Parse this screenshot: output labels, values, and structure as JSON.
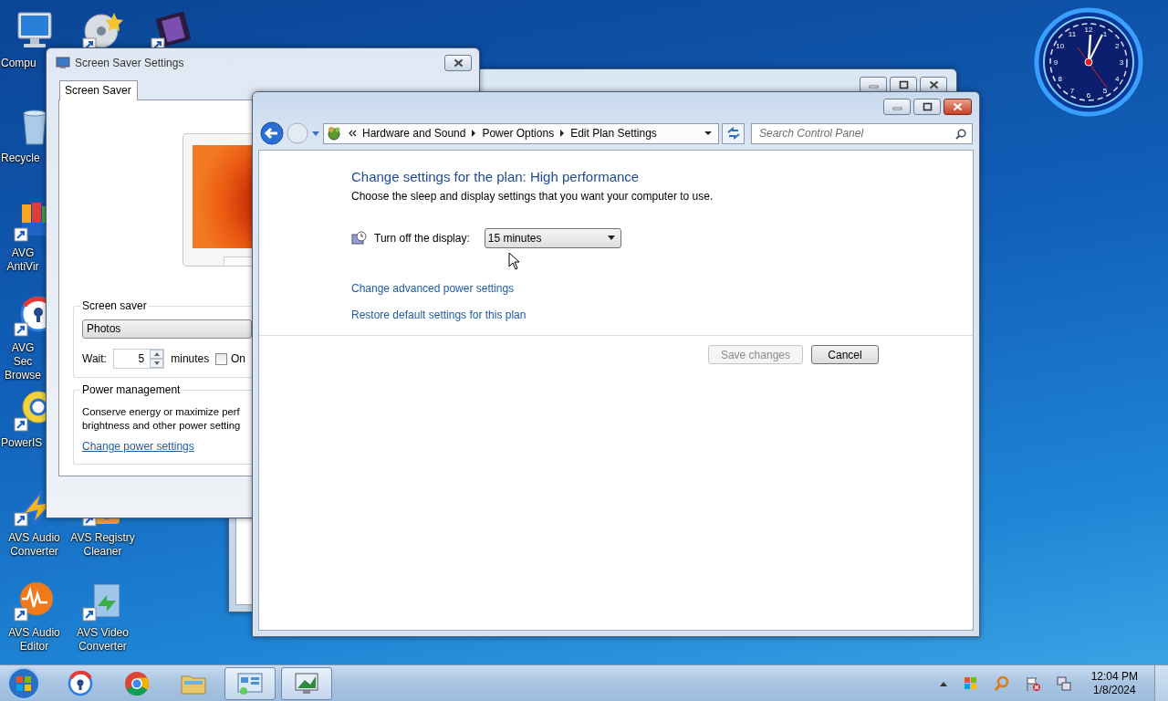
{
  "desktop_icons": [
    {
      "kind": "computer",
      "label": "Compu"
    },
    {
      "kind": "disc"
    },
    {
      "kind": "film"
    },
    {
      "kind": "recycle-bin",
      "label": "Recycle"
    },
    {
      "kind": "avg-antivirus",
      "label": "AVG AntiVir"
    },
    {
      "kind": "avg-browser",
      "label": "AVG Sec Browse"
    },
    {
      "kind": "poweriso",
      "label": "PowerIS"
    },
    {
      "kind": "avs-audio-converter",
      "label": "AVS Audio Converter"
    },
    {
      "kind": "avs-registry-cleaner",
      "label": "AVS Registry Cleaner"
    },
    {
      "kind": "avs-audio-editor",
      "label": "AVS Audio Editor"
    },
    {
      "kind": "avs-video-converter",
      "label": "AVS Video Converter"
    }
  ],
  "clock_gadget": {
    "numerals": [
      "12",
      "1",
      "2",
      "3",
      "4",
      "5",
      "6",
      "7",
      "8",
      "9",
      "10",
      "11"
    ]
  },
  "screen_saver_window": {
    "title": "Screen Saver Settings",
    "tabs": [
      {
        "label": "Screen Saver",
        "selected": true
      }
    ],
    "screen_saver_group": {
      "label": "Screen saver",
      "value": "Photos",
      "wait_label": "Wait:",
      "wait_value": "5",
      "wait_unit": "minutes",
      "resume_checkbox": {
        "label": "On",
        "checked": false
      }
    },
    "power_group": {
      "label": "Power management",
      "description_lines": [
        "Conserve energy or maximize perf",
        "brightness and other power setting"
      ],
      "link": "Change power settings"
    }
  },
  "control_panel_window": {
    "breadcrumb": [
      "Hardware and Sound",
      "Power Options",
      "Edit Plan Settings"
    ],
    "search": {
      "placeholder": "Search Control Panel"
    },
    "heading": "Change settings for the plan: High performance",
    "subheading": "Choose the sleep and display settings that you want your computer to use.",
    "display_setting": {
      "label": "Turn off the display:",
      "value": "15 minutes"
    },
    "links": [
      "Change advanced power settings",
      "Restore default settings for this plan"
    ],
    "buttons": [
      {
        "label": "Save changes",
        "disabled": true
      },
      {
        "label": "Cancel",
        "disabled": false
      }
    ]
  },
  "taskbar": {
    "buttons": [
      {
        "kind": "avg-browser",
        "active": false
      },
      {
        "kind": "chrome",
        "active": false
      },
      {
        "kind": "folder",
        "active": false
      },
      {
        "kind": "control-panel",
        "active": true
      },
      {
        "kind": "screensaver",
        "active": true
      }
    ],
    "time": "12:04 PM",
    "date": "1/8/2024"
  }
}
